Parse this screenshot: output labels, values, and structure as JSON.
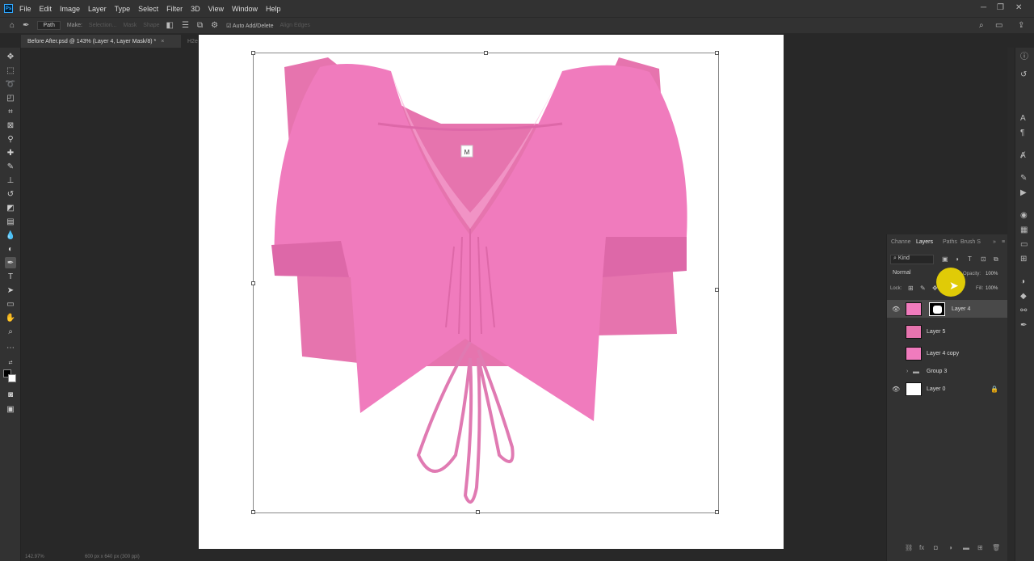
{
  "menubar": {
    "logo": "Ps",
    "items": [
      "File",
      "Edit",
      "Image",
      "Layer",
      "Type",
      "Select",
      "Filter",
      "3D",
      "View",
      "Window",
      "Help"
    ]
  },
  "options": {
    "tool_mode": "Path",
    "make_label": "Make:",
    "selection_label": "Selection...",
    "mask_label": "Mask",
    "shape_label": "Shape",
    "auto_add_delete": "Auto Add/Delete",
    "align_edges": "Align Edges"
  },
  "tabs": {
    "active": "Before After.psd @ 143% (Layer 4, Layer Mask/8) *",
    "inactive": "H2e"
  },
  "canvas": {
    "size_tag": "M"
  },
  "status": {
    "zoom": "142.97%",
    "doc_size": "600 px x 640 px (300 ppi)"
  },
  "layers_panel": {
    "tabs": [
      "Channe",
      "Layers",
      "Paths",
      "Brush S"
    ],
    "active_tab": "Layers",
    "filter_kind": "Kind",
    "blend_mode": "Normal",
    "opacity_label": "Opacity:",
    "opacity_value": "100%",
    "lock_label": "Lock:",
    "fill_label": "Fill:",
    "fill_value": "100%",
    "layers": [
      {
        "name": "Layer 4",
        "visible": true,
        "selected": true
      },
      {
        "name": "Layer 5",
        "visible": false,
        "selected": false
      },
      {
        "name": "Layer 4 copy",
        "visible": false,
        "selected": false
      },
      {
        "name": "Group 3",
        "visible": false,
        "selected": false
      },
      {
        "name": "Layer 0",
        "visible": true,
        "selected": false
      }
    ]
  },
  "colors": {
    "shirt_pink": "#f07bbd",
    "shirt_dark": "#dd68a8",
    "back_pink": "#e674ae",
    "highlight_yellow": "#ffe600",
    "ui_bg": "#323232",
    "canvas_bg": "#282828"
  }
}
